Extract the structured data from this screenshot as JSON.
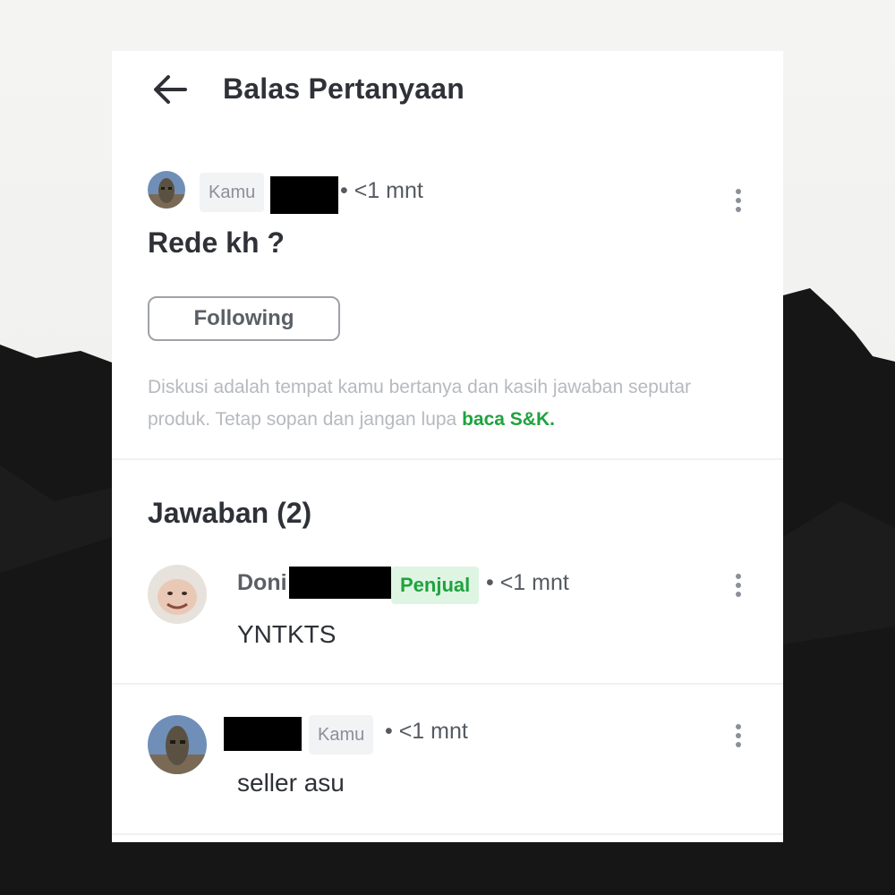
{
  "header": {
    "title": "Balas Pertanyaan",
    "back_icon": "arrow-left-icon"
  },
  "question": {
    "author_badge": "Kamu",
    "time": "• <1 mnt",
    "text": "Rede kh ?",
    "follow_button": "Following",
    "disclaimer_text": "Diskusi adalah tempat kamu bertanya dan kasih jawaban seputar produk. Tetap sopan dan jangan lupa ",
    "disclaimer_link": "baca S&K."
  },
  "answers": {
    "title": "Jawaban (2)",
    "items": [
      {
        "name": "Doni",
        "badge": "Penjual",
        "time": "• <1 mnt",
        "text": "YNTKTS"
      },
      {
        "badge": "Kamu",
        "time": "• <1 mnt",
        "text": "seller asu"
      }
    ]
  },
  "colors": {
    "text_primary": "#2e3137",
    "text_secondary": "#5a5f66",
    "muted": "#b6b9be",
    "accent_green": "#1ea33e",
    "seller_badge_bg": "#dff5e3",
    "redaction": "#000000"
  }
}
